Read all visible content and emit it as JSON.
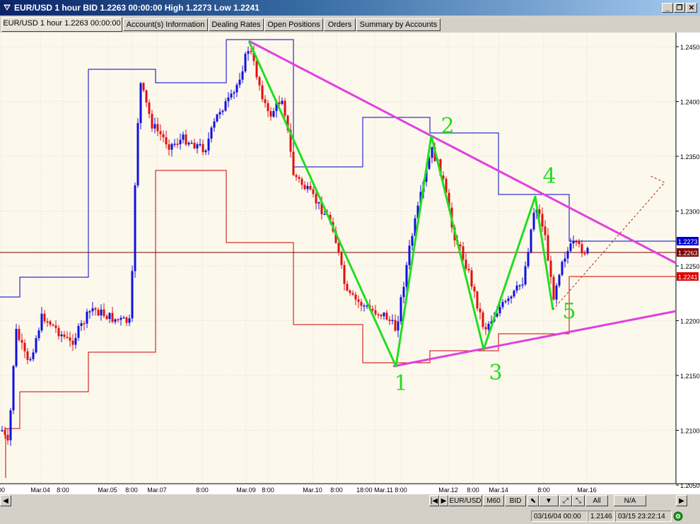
{
  "window": {
    "title": "EUR/USD 1 hour BID 1.2263 00:00:00 High 1.2273 Low 1.2241",
    "controls": {
      "minimize": "_",
      "restore": "❐",
      "close": "✕"
    }
  },
  "tabs": [
    {
      "label": "EUR/USD 1 hour 1.2263 00:00:00",
      "active": true
    },
    {
      "label": "Account(s) Information",
      "active": false
    },
    {
      "label": "Dealing Rates",
      "active": false
    },
    {
      "label": "Open Positions",
      "active": false
    },
    {
      "label": "Orders",
      "active": false
    },
    {
      "label": "Summary by Accounts",
      "active": false
    }
  ],
  "chart": {
    "price_levels": [
      "1.2450",
      "1.2400",
      "1.2350",
      "1.2300",
      "1.2250",
      "1.2200",
      "1.2150",
      "1.2100",
      "1.2050"
    ],
    "time_labels": [
      "00",
      "Mar.04",
      "8:00",
      "Mar.05",
      "8:00",
      "Mar.07",
      "8:00",
      "Mar.09",
      "8:00",
      "Mar.10",
      "8:00",
      "18:00 Mar.11",
      "8:00",
      "Mar.12",
      "8:00",
      "Mar.14",
      "8:00",
      "Mar.16"
    ],
    "price_tags": {
      "high": "1.2273",
      "bid": "1.2263",
      "low": "1.2241"
    },
    "wave_labels": [
      "1",
      "2",
      "3",
      "4",
      "5"
    ],
    "colors": {
      "background": "#fdf8ec",
      "up_candle": "#1010e0",
      "down_candle": "#e01010",
      "wave": "#22dd22",
      "trendline": "#e040e0",
      "upper_channel": "#0000cc",
      "lower_channel": "#cc0000"
    }
  },
  "bottom": {
    "symbol": "EUR/USD",
    "period": "M60",
    "price_type": "BID",
    "btn_all": "All",
    "btn_na": "N/A",
    "cursor_time": "03/16/04 00:00",
    "cursor_price": "1.2146",
    "server_time": "03/15 23:22:14"
  }
}
